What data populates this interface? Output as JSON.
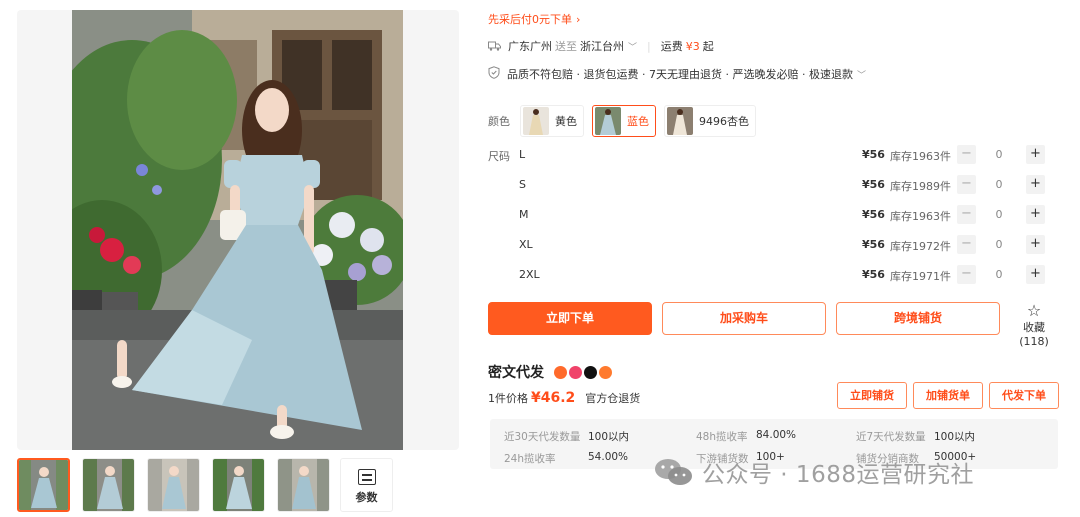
{
  "gallery": {
    "thumb_count": 5,
    "active_thumb": 0,
    "params_label": "参数"
  },
  "bnpl": {
    "label": "先采后付0元下单"
  },
  "shipping": {
    "from": "广东广州",
    "to_word": "送至",
    "to": "浙江台州",
    "fee_label": "运费",
    "fee_value": "¥3",
    "fee_suffix": "起"
  },
  "guarantees": {
    "text": "品质不符包赔 · 退货包运费 · 7天无理由退货 · 严选晚发必赔 · 极速退款"
  },
  "colors": {
    "label": "颜色",
    "options": [
      {
        "label": "黄色",
        "selected": false
      },
      {
        "label": "蓝色",
        "selected": true
      },
      {
        "label": "9496杏色",
        "selected": false
      }
    ]
  },
  "sizes": {
    "label": "尺码",
    "rows": [
      {
        "name": "L",
        "price": "¥56",
        "stock": "库存1963件",
        "qty": "0"
      },
      {
        "name": "S",
        "price": "¥56",
        "stock": "库存1989件",
        "qty": "0"
      },
      {
        "name": "M",
        "price": "¥56",
        "stock": "库存1963件",
        "qty": "0"
      },
      {
        "name": "XL",
        "price": "¥56",
        "stock": "库存1972件",
        "qty": "0"
      },
      {
        "name": "2XL",
        "price": "¥56",
        "stock": "库存1971件",
        "qty": "0"
      }
    ],
    "minus": "−",
    "plus": "+"
  },
  "actions": {
    "order_now": "立即下单",
    "add_to_cart": "加采购车",
    "cross_border": "跨境铺货",
    "favorite_label": "收藏",
    "favorite_count": "(118)"
  },
  "seller": {
    "name": "密文代发",
    "price_label": "1件价格",
    "price_value": "¥46.2",
    "warehouse": "官方仓退货",
    "buttons": {
      "list_now": "立即铺货",
      "add_list": "加铺货单",
      "dropship": "代发下单"
    }
  },
  "stats": [
    {
      "key": "近30天代发数量",
      "value": "100以内"
    },
    {
      "key": "48h揽收率",
      "value": "84.00%"
    },
    {
      "key": "近7天代发数量",
      "value": "100以内"
    },
    {
      "key": "24h揽收率",
      "value": "54.00%"
    },
    {
      "key": "下游铺货数",
      "value": "100+"
    },
    {
      "key": "铺货分销商数",
      "value": "50000+"
    }
  ],
  "watermark": {
    "text": "公众号 · 1688运营研究社"
  },
  "colors_theme": {
    "accent": "#ff5a1f",
    "accent_text": "#ff4d1a",
    "stats_bg": "#f5f5f5"
  }
}
